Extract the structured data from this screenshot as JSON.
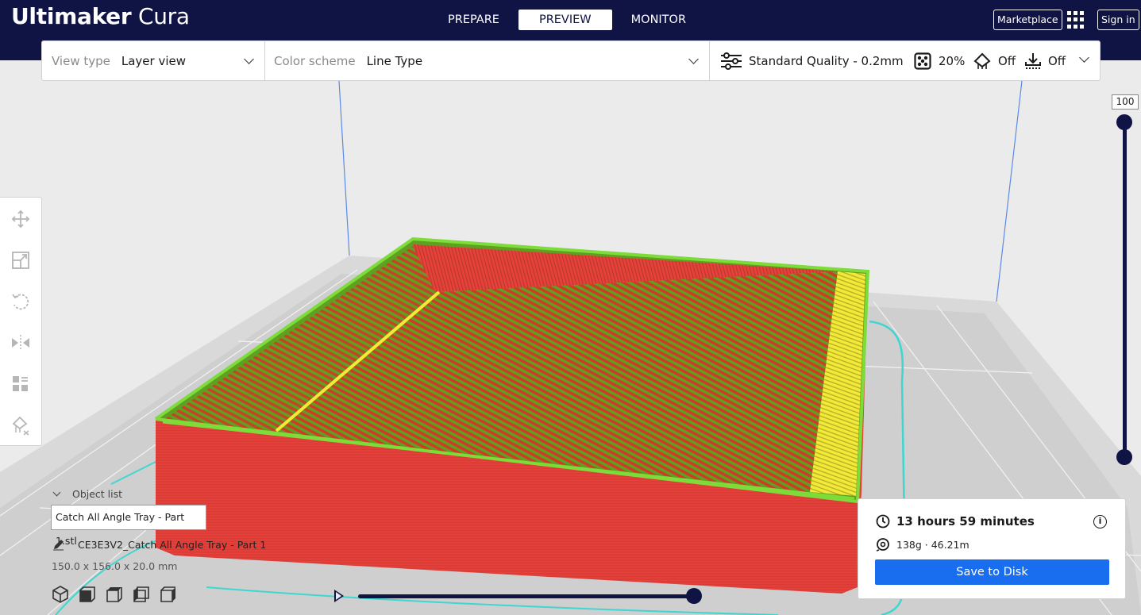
{
  "app": {
    "title_bold": "Ultimaker",
    "title_light": "Cura"
  },
  "stages": [
    {
      "label": "PREPARE",
      "active": false
    },
    {
      "label": "PREVIEW",
      "active": true
    },
    {
      "label": "MONITOR",
      "active": false
    }
  ],
  "header": {
    "marketplace_label": "Marketplace",
    "signin_label": "Sign in",
    "apps_icon": "apps-grid-icon"
  },
  "toolbar": {
    "view_type_label": "View type",
    "view_type_value": "Layer view",
    "color_scheme_label": "Color scheme",
    "color_scheme_value": "Line Type",
    "quality": "Standard Quality - 0.2mm",
    "infill": "20%",
    "support": "Off",
    "adhesion": "Off"
  },
  "tools": [
    "move-icon",
    "scale-icon",
    "rotate-icon",
    "mirror-icon",
    "per-model-settings-icon",
    "support-blocker-icon"
  ],
  "layer": {
    "current": "100"
  },
  "object_list": {
    "header": "Object list",
    "tooltip": "Catch All Angle Tray - Part 1.stl",
    "job_name": "CE3E3V2_Catch All Angle Tray - Part 1",
    "dimensions": "150.0 x 156.0 x 20.0 mm"
  },
  "camera_views": [
    "3d-view-icon",
    "front-view-icon",
    "top-view-icon",
    "left-view-icon",
    "right-view-icon"
  ],
  "print_info": {
    "time": "13 hours 59 minutes",
    "material": "138g · 46.21m",
    "save_label": "Save to Disk"
  },
  "colors": {
    "header_bg": "#0f1444",
    "accent_blue": "#196ef0",
    "wall_red": "#e8403a",
    "skin_green": "#7ddb3a",
    "top_yellow": "#f2ea37",
    "travel_cyan": "#3fd6d0"
  }
}
